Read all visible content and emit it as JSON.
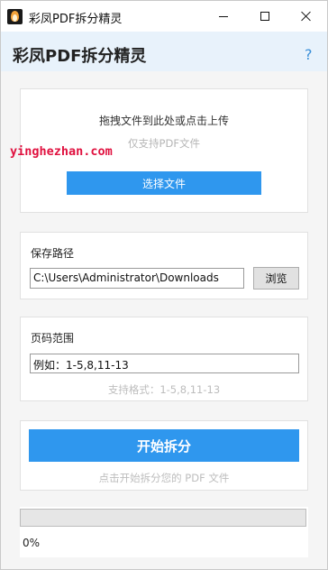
{
  "window": {
    "title": "彩凤PDF拆分精灵",
    "controls": [
      "minimize-icon",
      "maximize-icon",
      "close-icon"
    ]
  },
  "header": {
    "app_name": "彩凤PDF拆分精灵",
    "help_label": "?"
  },
  "upload": {
    "drop_hint": "拖拽文件到此处或点击上传",
    "sub_hint": "仅支持PDF文件",
    "select_button": "选择文件",
    "watermark": "yinghezhan.com"
  },
  "save": {
    "label": "保存路径",
    "path_value": "C:\\Users\\Administrator\\Downloads",
    "browse_button": "浏览"
  },
  "range": {
    "label": "页码范围",
    "input_value": "例如：1-5,8,11-13",
    "format_hint": "支持格式：1-5,8,11-13"
  },
  "start": {
    "button": "开始拆分",
    "hint": "点击开始拆分您的 PDF 文件"
  },
  "progress": {
    "percent": 0,
    "label": "0%"
  },
  "colors": {
    "accent": "#2f97ee",
    "header_bg": "#e8f2fb",
    "watermark": "#e0113f"
  }
}
